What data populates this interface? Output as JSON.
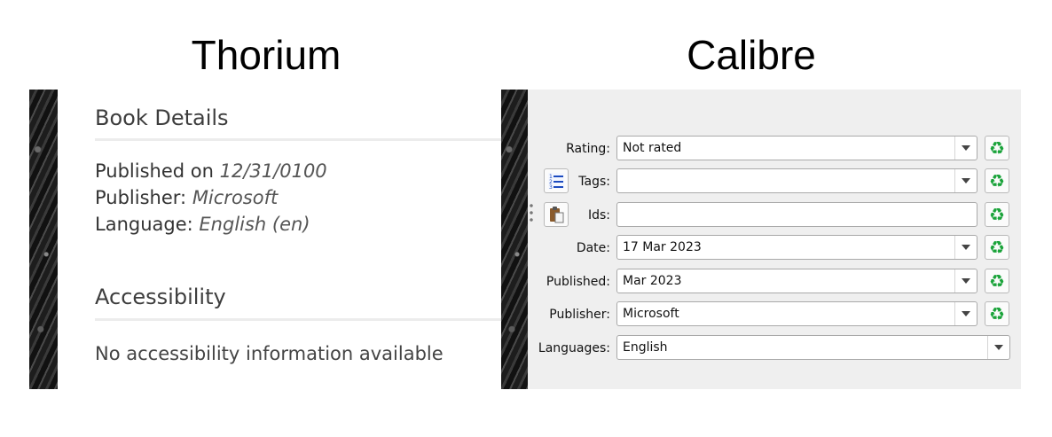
{
  "headings": {
    "thorium": "Thorium",
    "calibre": "Calibre"
  },
  "thorium": {
    "book_details_title": "Book Details",
    "published_label": "Published on",
    "published_value": "12/31/0100",
    "publisher_label": "Publisher:",
    "publisher_value": "Microsoft",
    "language_label": "Language:",
    "language_value": "English (en)",
    "accessibility_title": "Accessibility",
    "accessibility_text": "No accessibility information available"
  },
  "calibre": {
    "rating": {
      "label": "Rating:",
      "value": "Not rated"
    },
    "tags": {
      "label": "Tags:",
      "value": ""
    },
    "ids": {
      "label": "Ids:",
      "value": ""
    },
    "date": {
      "label": "Date:",
      "value": "17 Mar 2023"
    },
    "published": {
      "label": "Published:",
      "value": "Mar 2023"
    },
    "publisher": {
      "label": "Publisher:",
      "value": "Microsoft"
    },
    "languages": {
      "label": "Languages:",
      "value": "English"
    },
    "reset_icon": "♻"
  },
  "colors": {
    "recycle_green": "#1aa33a",
    "calibre_bg": "#efefef"
  }
}
